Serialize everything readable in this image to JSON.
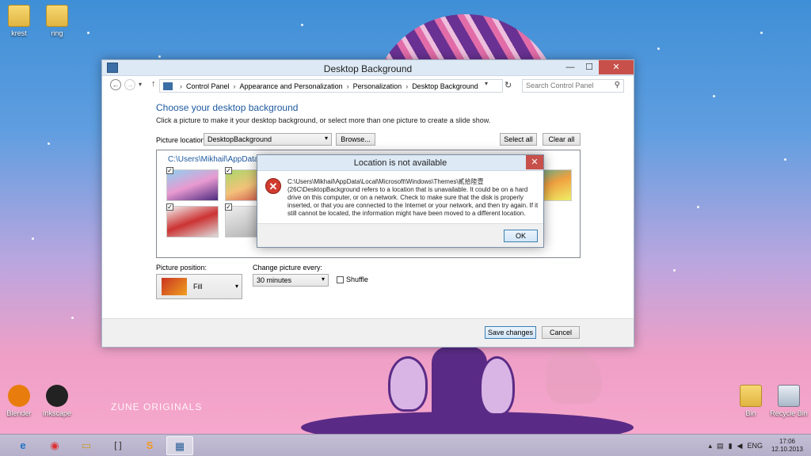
{
  "desktop": {
    "icons_top": [
      {
        "label": "krest"
      },
      {
        "label": "ring"
      }
    ],
    "icons_bottom_left": [
      {
        "label": "Blender"
      },
      {
        "label": "Inkscape"
      }
    ],
    "icons_bottom_right": [
      {
        "label": "Bin"
      },
      {
        "label": "Recycle Bin"
      }
    ],
    "zune_brand": "ZUNE ORIGINALS",
    "colors": {
      "sky_top": "#3f8fd6",
      "sky_bottom": "#f6a7cc",
      "purple": "#5a2b86"
    }
  },
  "window": {
    "title": "Desktop Background",
    "controls": {
      "minimize": "—",
      "maximize": "☐",
      "close": "✕"
    },
    "nav": {
      "back": "←",
      "forward": "→",
      "dropdown": "▾",
      "up": "↑",
      "refresh": "↻"
    },
    "breadcrumbs": [
      "Control Panel",
      "Appearance and Personalization",
      "Personalization",
      "Desktop Background"
    ],
    "search": {
      "placeholder": "Search Control Panel"
    },
    "heading": "Choose your desktop background",
    "subtitle": "Click a picture to make it your desktop background, or select more than one picture to create a slide show.",
    "picture_location": {
      "label": "Picture location:",
      "value": "DesktopBackground",
      "browse": "Browse..."
    },
    "select_all": "Select all",
    "clear_all": "Clear all",
    "folder_path": "C:\\Users\\Mikhail\\AppData\\",
    "picture_position": {
      "label": "Picture position:",
      "value": "Fill"
    },
    "change_every": {
      "label": "Change picture every:",
      "value": "30 minutes"
    },
    "shuffle": "Shuffle",
    "save_changes": "Save changes",
    "cancel": "Cancel"
  },
  "dialog": {
    "title": "Location is not available",
    "close": "✕",
    "error_icon": "✕",
    "message": "C:\\Users\\Mikhail\\AppData\\Local\\Microsoft\\Windows\\Themes\\貳拾陸壹 (26C\\DesktopBackground refers to a location that is unavailable. It could be on a hard drive on this computer, or on a network. Check to make sure that the disk is properly inserted, or that you are connected to the Internet or your network, and then try again. If it still cannot be located, the information might have been moved to a different location.",
    "ok": "OK"
  },
  "taskbar": {
    "apps": [
      {
        "name": "internet-explorer",
        "glyph": "e"
      },
      {
        "name": "chrome",
        "glyph": "◉"
      },
      {
        "name": "file-explorer",
        "glyph": "▭"
      },
      {
        "name": "brackets",
        "glyph": "[ ]"
      },
      {
        "name": "sublime-text",
        "glyph": "S"
      },
      {
        "name": "control-panel",
        "glyph": "▦"
      }
    ],
    "language": "ENG",
    "time": "17:06",
    "date": "12.10.2013"
  }
}
